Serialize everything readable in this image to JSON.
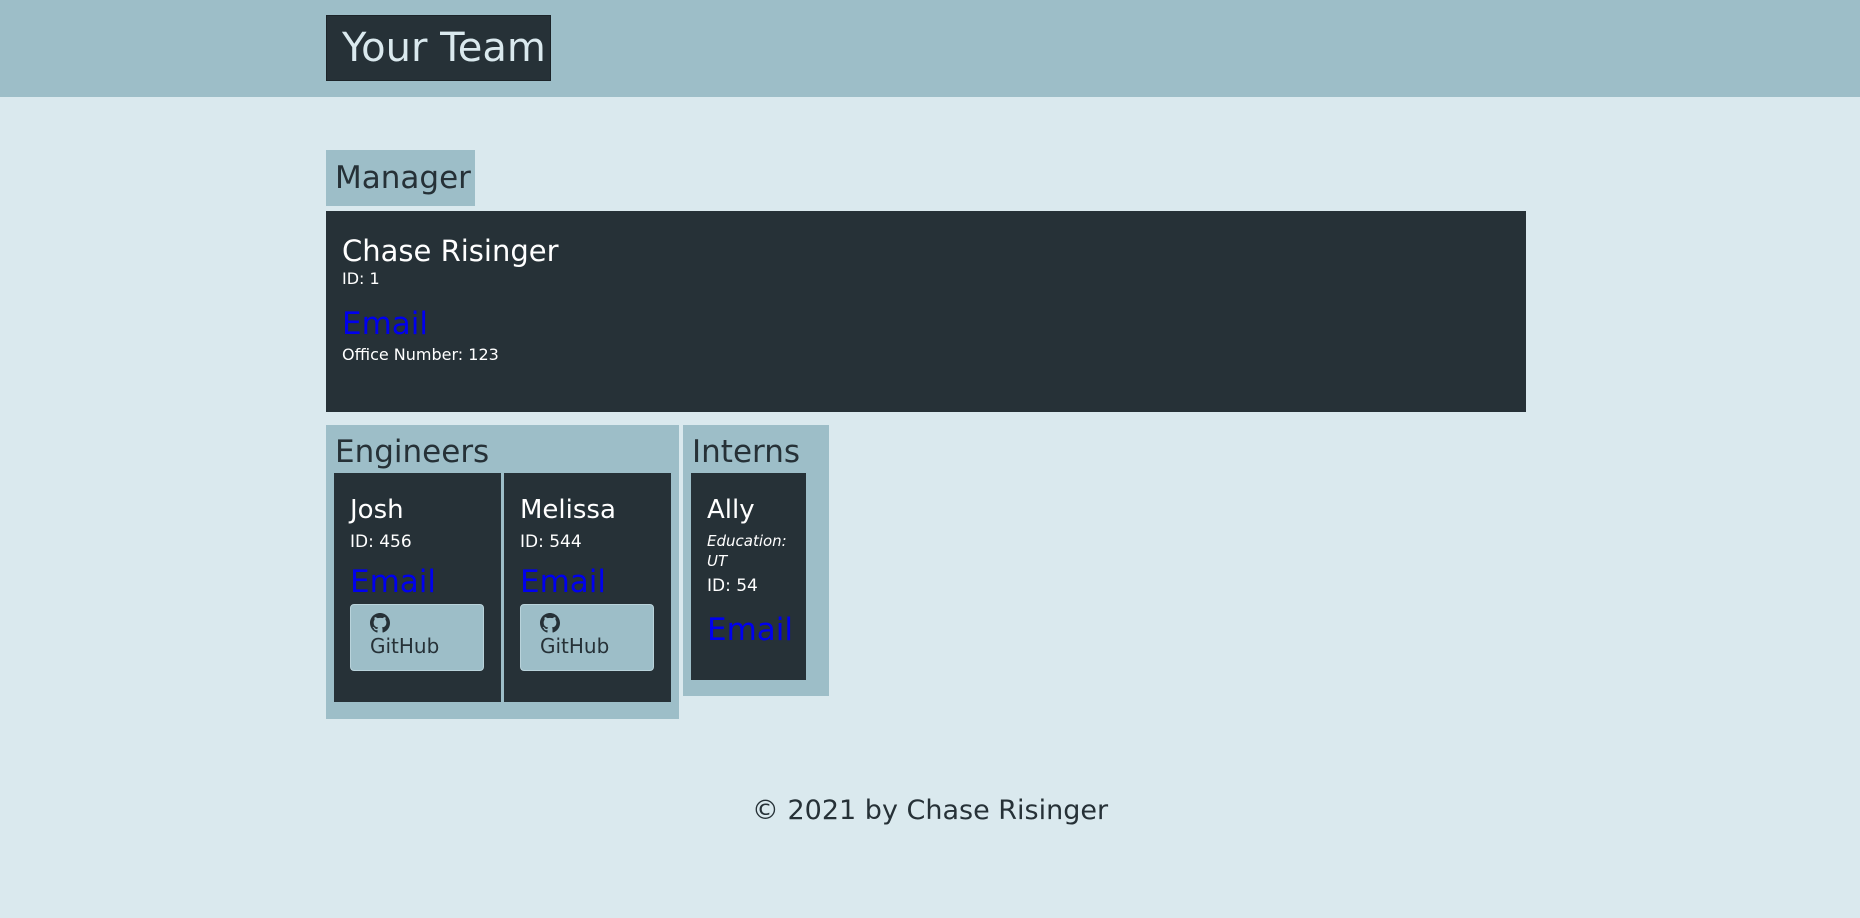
{
  "header": {
    "title": "Your Team"
  },
  "manager": {
    "section_label": "Manager",
    "name": "Chase Risinger",
    "id": "ID: 1",
    "email_label": "Email",
    "office": "Office Number: 123"
  },
  "engineers": {
    "section_label": "Engineers",
    "items": [
      {
        "name": "Josh",
        "id": "ID: 456",
        "email_label": "Email",
        "github_label": "GitHub"
      },
      {
        "name": "Melissa",
        "id": "ID: 544",
        "email_label": "Email",
        "github_label": "GitHub"
      }
    ]
  },
  "interns": {
    "section_label": "Interns",
    "items": [
      {
        "name": "Ally",
        "education": "Education: UT",
        "id": "ID: 54",
        "email_label": "Email"
      }
    ]
  },
  "footer": {
    "text": "© 2021 by Chase Risinger"
  },
  "colors": {
    "background": "#dae9ee",
    "accent": "#9dbec8",
    "card": "#263137",
    "link": "#0000ee"
  },
  "icons": {
    "github": "github-icon"
  }
}
